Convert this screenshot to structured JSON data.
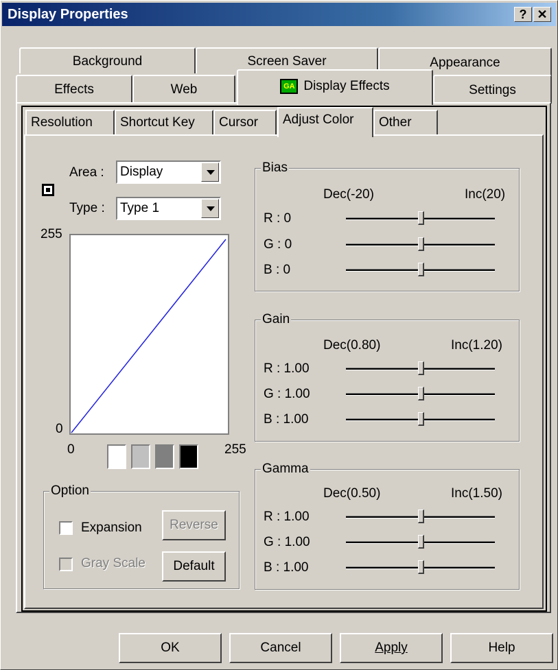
{
  "window": {
    "title": "Display Properties",
    "help_glyph": "?",
    "close_glyph": "✕"
  },
  "tabs": {
    "row1": [
      "Background",
      "Screen Saver",
      "Appearance"
    ],
    "row2": [
      "Effects",
      "Web",
      "Display Effects",
      "Settings"
    ],
    "active_icon_label": "GA"
  },
  "subtabs": [
    "Resolution",
    "Shortcut Key",
    "Cursor",
    "Adjust Color",
    "Other"
  ],
  "left": {
    "area_label": "Area :",
    "area_value": "Display",
    "type_label": "Type :",
    "type_value": "Type 1",
    "curve": {
      "y_max": "255",
      "y_min": "0",
      "x_min": "0",
      "x_max": "255"
    },
    "swatch_colors": [
      "#ffffff",
      "#c0c0c0",
      "#808080",
      "#000000"
    ]
  },
  "option": {
    "caption": "Option",
    "expansion_label": "Expansion",
    "expansion_checked": false,
    "grayscale_label": "Gray Scale",
    "reverse_label": "Reverse",
    "default_label": "Default"
  },
  "bias": {
    "caption": "Bias",
    "dec": "Dec(-20)",
    "inc": "Inc(20)",
    "rows": [
      {
        "label": "R : 0",
        "value": 0.5
      },
      {
        "label": "G : 0",
        "value": 0.5
      },
      {
        "label": "B : 0",
        "value": 0.5
      }
    ]
  },
  "gain": {
    "caption": "Gain",
    "dec": "Dec(0.80)",
    "inc": "Inc(1.20)",
    "rows": [
      {
        "label": "R : 1.00",
        "value": 0.5
      },
      {
        "label": "G : 1.00",
        "value": 0.5
      },
      {
        "label": "B : 1.00",
        "value": 0.5
      }
    ]
  },
  "gamma": {
    "caption": "Gamma",
    "dec": "Dec(0.50)",
    "inc": "Inc(1.50)",
    "rows": [
      {
        "label": "R : 1.00",
        "value": 0.5
      },
      {
        "label": "G : 1.00",
        "value": 0.5
      },
      {
        "label": "B : 1.00",
        "value": 0.5
      }
    ]
  },
  "footer": {
    "ok": "OK",
    "cancel": "Cancel",
    "apply": "Apply",
    "help": "Help"
  }
}
